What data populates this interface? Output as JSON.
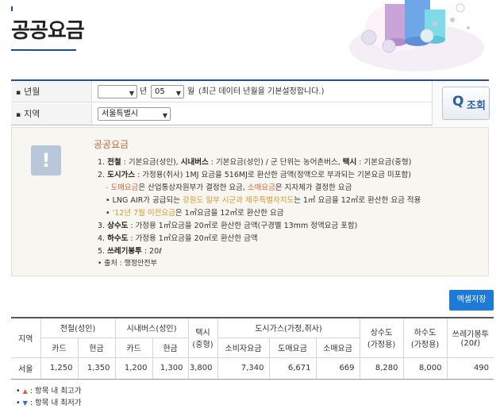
{
  "page": {
    "title": "공공요금"
  },
  "search": {
    "year_month_label": "년월",
    "year_value": "",
    "year_unit": "년",
    "month_value": "05",
    "month_unit": "월",
    "date_note": "(최근 데이터 년월을 기본설정합니다.)",
    "region_label": "지역",
    "region_value": "서울특별시",
    "search_button_label": "조회"
  },
  "notice": {
    "title": "공공요금",
    "line1": {
      "prefix": "1. ",
      "bold1": "전철",
      "text1": " : 기본요금(성인), ",
      "bold2": "시내버스",
      "text2": " : 기본요금(성인) / 군 단위는 농어촌버스, ",
      "bold3": "택시",
      "text3": " : 기본요금(중형)"
    },
    "line2": {
      "prefix": "2. ",
      "bold": "도시가스",
      "text": " : 가정용(취사) 1MJ 요금을 516MJ로 환산한 금액(정액으로 부과되는 기본요금 미포함)"
    },
    "line2a": {
      "dash": "- ",
      "orange1": "도매요금",
      "text1": "은 산업통상자원부가 결정한 요금, ",
      "orange2": "소매요금",
      "text2": "은 지자체가 결정한 요금"
    },
    "line2b": {
      "bullet": "• ",
      "text1": "LNG AIR가 공급되는 ",
      "yellow": "강원도 일부 시군과 제주특별자치도",
      "text2": "는 1㎥ 요금을 12㎥로 환산한 요금 적용"
    },
    "line2c": {
      "bullet": "• ",
      "yellow": "'12년 7월 이전요금",
      "text": "은 1㎥요금을 12㎥로 환산한 요금"
    },
    "line3": {
      "prefix": "3. ",
      "bold": "상수도",
      "text": " : 가정용 1㎥요금을 20㎥로 환산한 금액(구경별 13mm 정액요금 포함)"
    },
    "line4": {
      "prefix": "4. ",
      "bold": "하수도",
      "text": " : 가정용 1㎥요금을 20㎥로 환산한 금액"
    },
    "line5": {
      "prefix": "5. ",
      "bold": "쓰레기봉투",
      "text": " : 20ℓ"
    },
    "source": "• 출처 : 행정안전부"
  },
  "excel_button_label": "엑셀저장",
  "table": {
    "headers": {
      "region": "지역",
      "subway": "전철(성인)",
      "bus": "시내버스(성인)",
      "taxi": "택시\n(중형)",
      "gas": "도시가스(가정,취사)",
      "water": "상수도\n(가정용)",
      "sewage": "하수도\n(가정용)",
      "trash": "쓰레기봉투\n(20ℓ)",
      "card": "카드",
      "cash": "현금",
      "gas_consumer": "소비자요금",
      "gas_wholesale": "도매요금",
      "gas_retail": "소매요금"
    },
    "rows": [
      {
        "region": "서울",
        "subway_card": "1,250",
        "subway_cash": "1,350",
        "bus_card": "1,200",
        "bus_cash": "1,300",
        "taxi": "3,800",
        "gas_consumer": "7,340",
        "gas_wholesale": "6,671",
        "gas_retail": "669",
        "water": "8,280",
        "sewage": "8,000",
        "trash": "490"
      }
    ]
  },
  "legend": {
    "high_label": ": 항목 내 최고가",
    "low_label": ": 항목 내 최저가"
  },
  "colors": {
    "accent": "#1c4f91",
    "orange": "#d0683a",
    "excel": "#1d7ad8"
  }
}
